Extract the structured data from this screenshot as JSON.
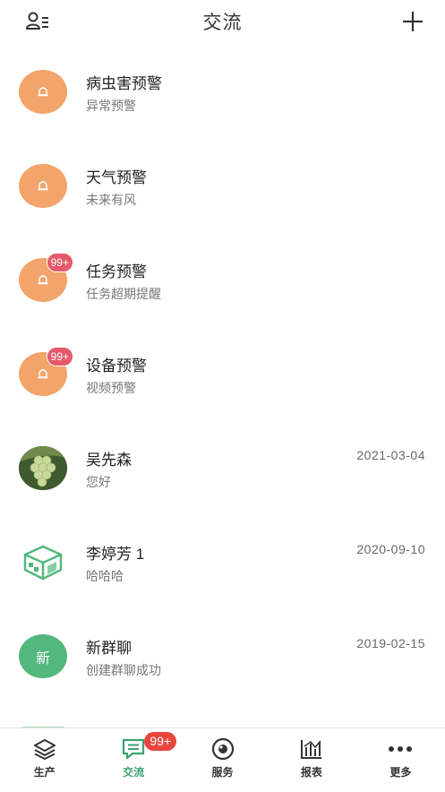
{
  "header": {
    "title": "交流"
  },
  "conversations": [
    {
      "name": "病虫害预警",
      "subtitle": "异常预警",
      "date": "",
      "badge": ""
    },
    {
      "name": "天气预警",
      "subtitle": "未来有风",
      "date": "",
      "badge": ""
    },
    {
      "name": "任务预警",
      "subtitle": "任务超期提醒",
      "date": "",
      "badge": "99+"
    },
    {
      "name": "设备预警",
      "subtitle": "视频预警",
      "date": "",
      "badge": "99+"
    },
    {
      "name": "吴先森",
      "subtitle": "您好",
      "date": "2021-03-04",
      "badge": ""
    },
    {
      "name": "李婷芳 1",
      "subtitle": "哈哈哈",
      "date": "2020-09-10",
      "badge": ""
    },
    {
      "name": "新群聊",
      "subtitle": "创建群聊成功",
      "date": "2019-02-15",
      "badge": "",
      "avatar_text": "新"
    }
  ],
  "tabs": [
    {
      "label": "生产",
      "icon": "layers-icon"
    },
    {
      "label": "交流",
      "icon": "chat-icon",
      "badge": "99+",
      "active": true
    },
    {
      "label": "服务",
      "icon": "eye-icon"
    },
    {
      "label": "报表",
      "icon": "chart-icon"
    },
    {
      "label": "更多",
      "icon": "more-icon"
    }
  ],
  "colors": {
    "alert_orange": "#f2a46a",
    "accent_green": "#3aa36f",
    "badge_red": "#e8463d",
    "avatar_green": "#52b87e"
  }
}
